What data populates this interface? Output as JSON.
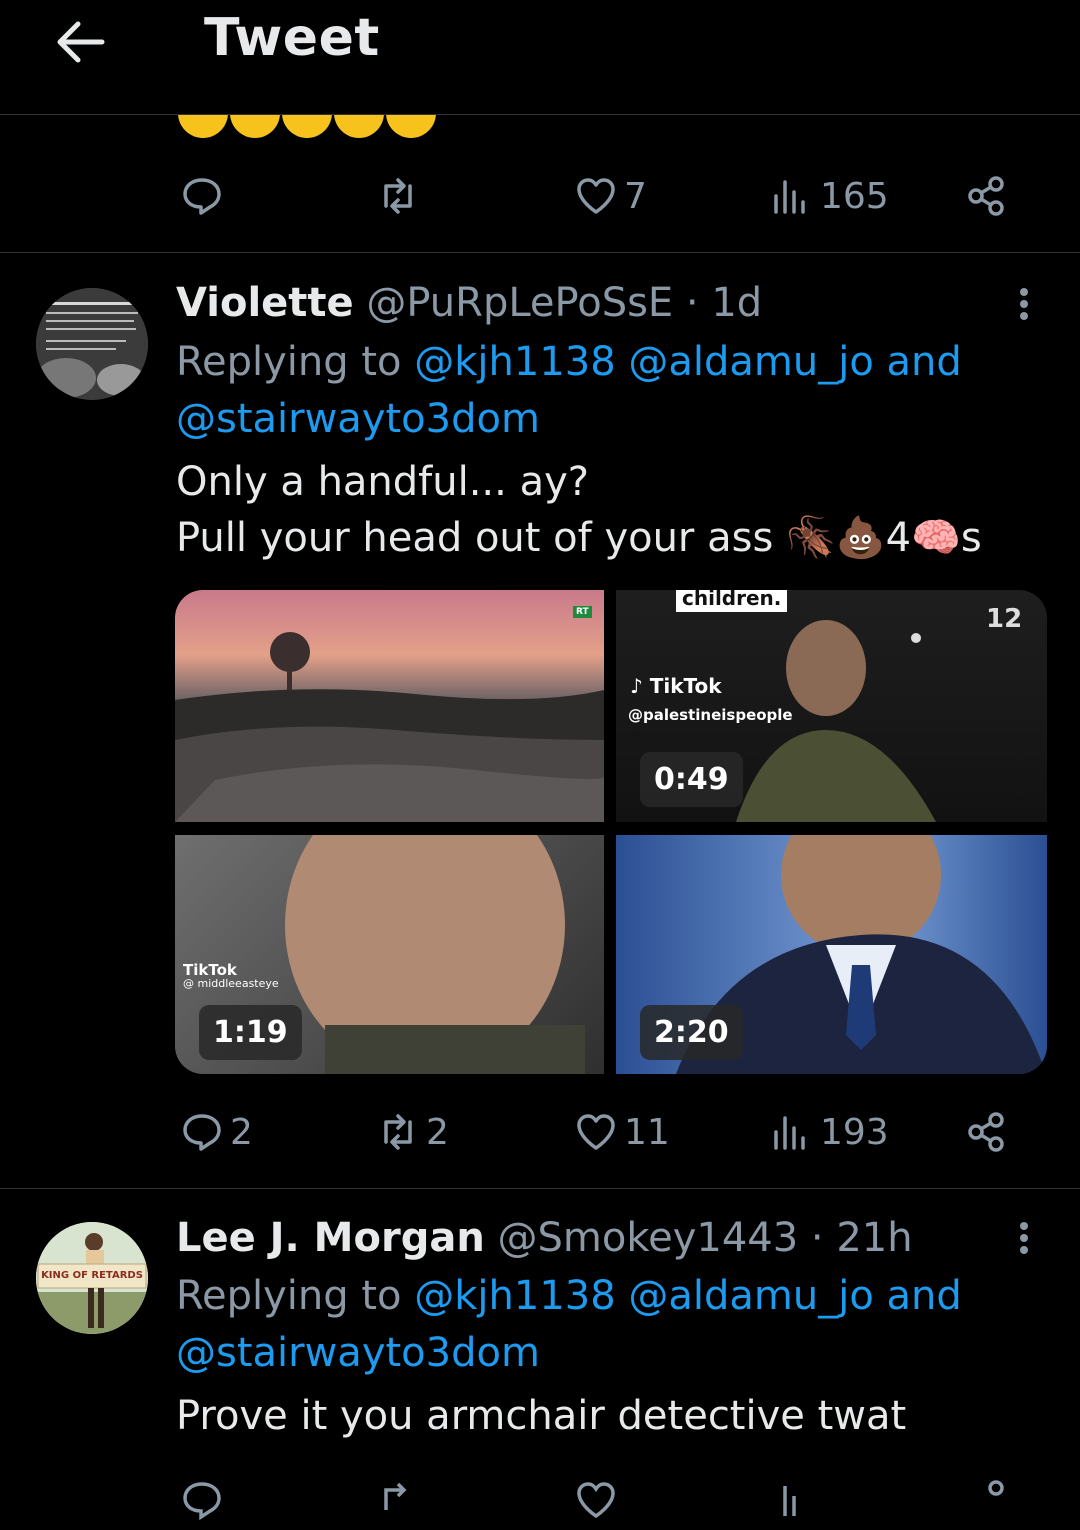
{
  "header": {
    "title": "Tweet"
  },
  "icons": {
    "back": "arrow-left-icon",
    "reply": "reply-icon",
    "retweet": "retweet-icon",
    "like": "heart-icon",
    "views": "views-icon",
    "share": "share-icon",
    "more": "more-vertical-icon"
  },
  "colors": {
    "background": "#000000",
    "text": "#e7e9ea",
    "muted": "#8b98a5",
    "link": "#1d9bf0",
    "divider": "#2f3336"
  },
  "prev_tweet": {
    "emoji_count": 5,
    "stats": {
      "replies": "",
      "retweets": "",
      "likes": "7",
      "views": "165"
    }
  },
  "tweets": [
    {
      "name": "Violette",
      "handle": "@PuRpLePoSsE",
      "time": "· 1d",
      "replying_prefix": "Replying to",
      "replying_users": [
        "@kjh1138",
        "@aldamu_jo",
        "and",
        "@stairwayto3dom"
      ],
      "text_lines": [
        "Only a handful... ay?",
        "Pull your head out of your ass 🪳💩4🧠s"
      ],
      "media": [
        {
          "duration": "",
          "watermark": "RT"
        },
        {
          "duration": "0:49",
          "overlay_top": "children.",
          "brand": "TikTok",
          "brand_handle": "@palestineispeople",
          "corner": "12"
        },
        {
          "duration": "1:19",
          "brand": "TikTok",
          "brand_handle": "@ middleeasteye"
        },
        {
          "duration": "2:20"
        }
      ],
      "stats": {
        "replies": "2",
        "retweets": "2",
        "likes": "11",
        "views": "193"
      }
    },
    {
      "name": "Lee J. Morgan",
      "handle": "@Smokey1443",
      "time": "· 21h",
      "replying_prefix": "Replying to",
      "replying_users": [
        "@kjh1138",
        "@aldamu_jo",
        "and",
        "@stairwayto3dom"
      ],
      "text_lines": [
        "Prove it you armchair detective twat"
      ],
      "avatar_sign": "KING OF RETARDS"
    }
  ]
}
